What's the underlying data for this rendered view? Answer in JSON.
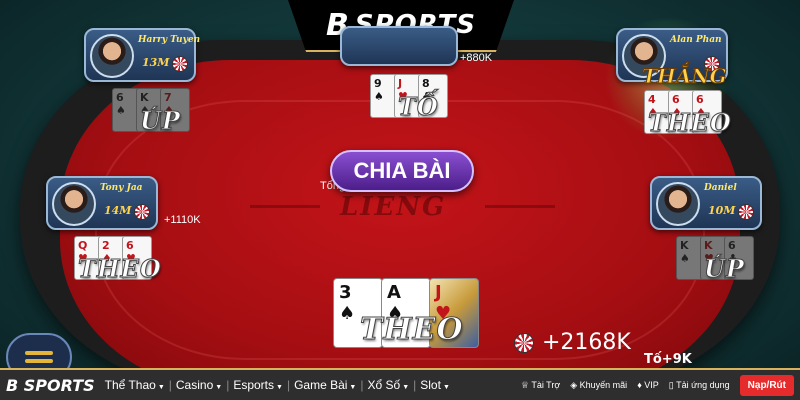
{
  "brand": {
    "logo_letter": "B",
    "name": "SPORTS"
  },
  "table": {
    "watermark": "LIENG",
    "deal_button": "CHIA BÀI",
    "pot_label": "Tổng"
  },
  "players": {
    "top_left": {
      "name": "Harry Tuyen",
      "chips": "13M",
      "action": "ÚP",
      "cards": [
        [
          "6",
          "♠"
        ],
        [
          "K",
          "♠"
        ],
        [
          "7",
          "♦"
        ]
      ]
    },
    "top_center": {
      "name": "",
      "chips": "",
      "bet": "+880K",
      "action": "TỐ",
      "cards": [
        [
          "9",
          "♠"
        ],
        [
          "J",
          "♥"
        ],
        [
          "8",
          "♣"
        ]
      ]
    },
    "top_right": {
      "name": "Alan Phan",
      "chips": "",
      "status": "THẮNG",
      "action": "THEO",
      "cards": [
        [
          "4",
          "♦"
        ],
        [
          "6",
          "♦"
        ],
        [
          "6",
          "♦"
        ]
      ]
    },
    "left": {
      "name": "Tony Jaa",
      "chips": "14M",
      "bet": "+1110K",
      "action": "THEO",
      "cards": [
        [
          "Q",
          "♥"
        ],
        [
          "2",
          "♦"
        ],
        [
          "6",
          "♥"
        ]
      ]
    },
    "right": {
      "name": "Daniel",
      "chips": "10M",
      "action": "ÚP",
      "cards": [
        [
          "K",
          "♠"
        ],
        [
          "K",
          "♥"
        ],
        [
          "6",
          "♣"
        ]
      ]
    }
  },
  "me": {
    "cards": [
      [
        "3",
        "♠"
      ],
      [
        "A",
        "♠"
      ],
      [
        "J",
        "♥"
      ]
    ],
    "action": "THEO",
    "bet": "+2168K",
    "raise_hint": "Tố+9K"
  },
  "nav": {
    "logo": "SPORTS",
    "items": [
      "Thể Thao",
      "Casino",
      "Esports",
      "Game Bài",
      "Xổ Số",
      "Slot"
    ],
    "right_links": [
      "Tài Trợ",
      "Khuyến mãi",
      "VIP",
      "Tải ứng dụng"
    ],
    "cta": "Nạp/Rút"
  }
}
